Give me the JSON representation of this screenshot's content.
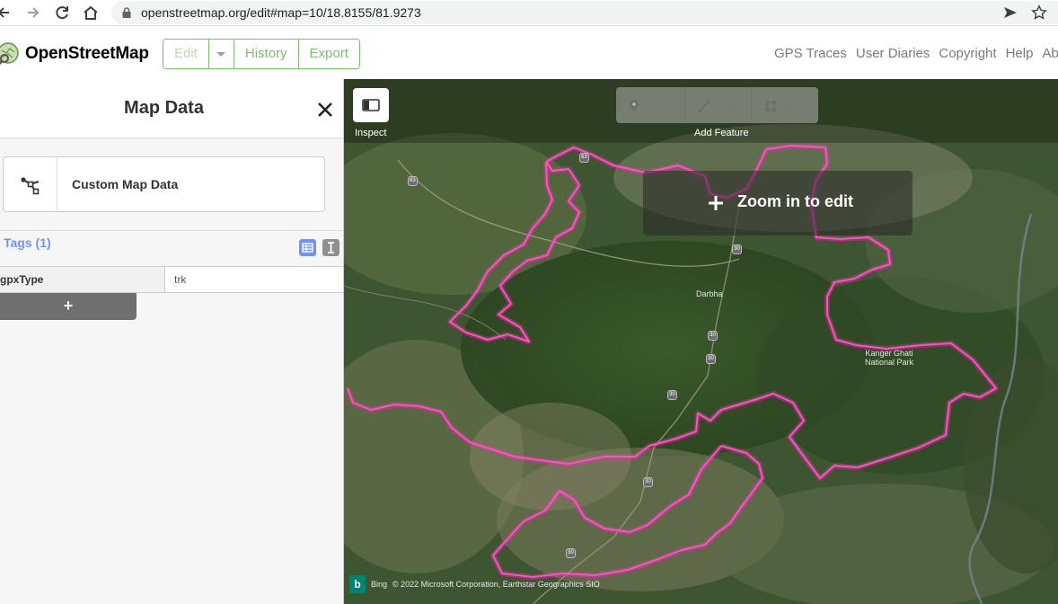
{
  "browser": {
    "url": "openstreetmap.org/edit#map=10/18.8155/81.9273"
  },
  "header": {
    "logo_text": "OpenStreetMap",
    "edit_label": "Edit",
    "history_label": "History",
    "export_label": "Export",
    "links": [
      "GPS Traces",
      "User Diaries",
      "Copyright",
      "Help",
      "About"
    ],
    "accent_color": "#7ebc6f"
  },
  "sidebar": {
    "title": "Map Data",
    "custom_data_label": "Custom Map Data",
    "tags_title": "Tags (1)",
    "tags": [
      {
        "key": "gpxType",
        "value": "trk"
      }
    ],
    "add_tag_label": "+"
  },
  "map": {
    "inspect_label": "Inspect",
    "modes": [
      {
        "label": "Point",
        "icon": "marker-icon"
      },
      {
        "label": "Line",
        "icon": "line-icon"
      },
      {
        "label": "Area",
        "icon": "area-icon"
      }
    ],
    "add_feature_label": "Add Feature",
    "zoom_notice": "Zoom in to edit",
    "place_labels": {
      "darbha": "Darbha",
      "park_line1": "Kanger Ghati",
      "park_line2": "National Park"
    },
    "road_shields": [
      "63",
      "63",
      "30",
      "30",
      "30",
      "30",
      "30",
      "30"
    ],
    "attribution": "© 2022 Microsoft Corporation, Earthstar Geographics SIO",
    "bing_logo": "b",
    "bing_text": "Bing",
    "track_color": "#ff3fbf"
  }
}
